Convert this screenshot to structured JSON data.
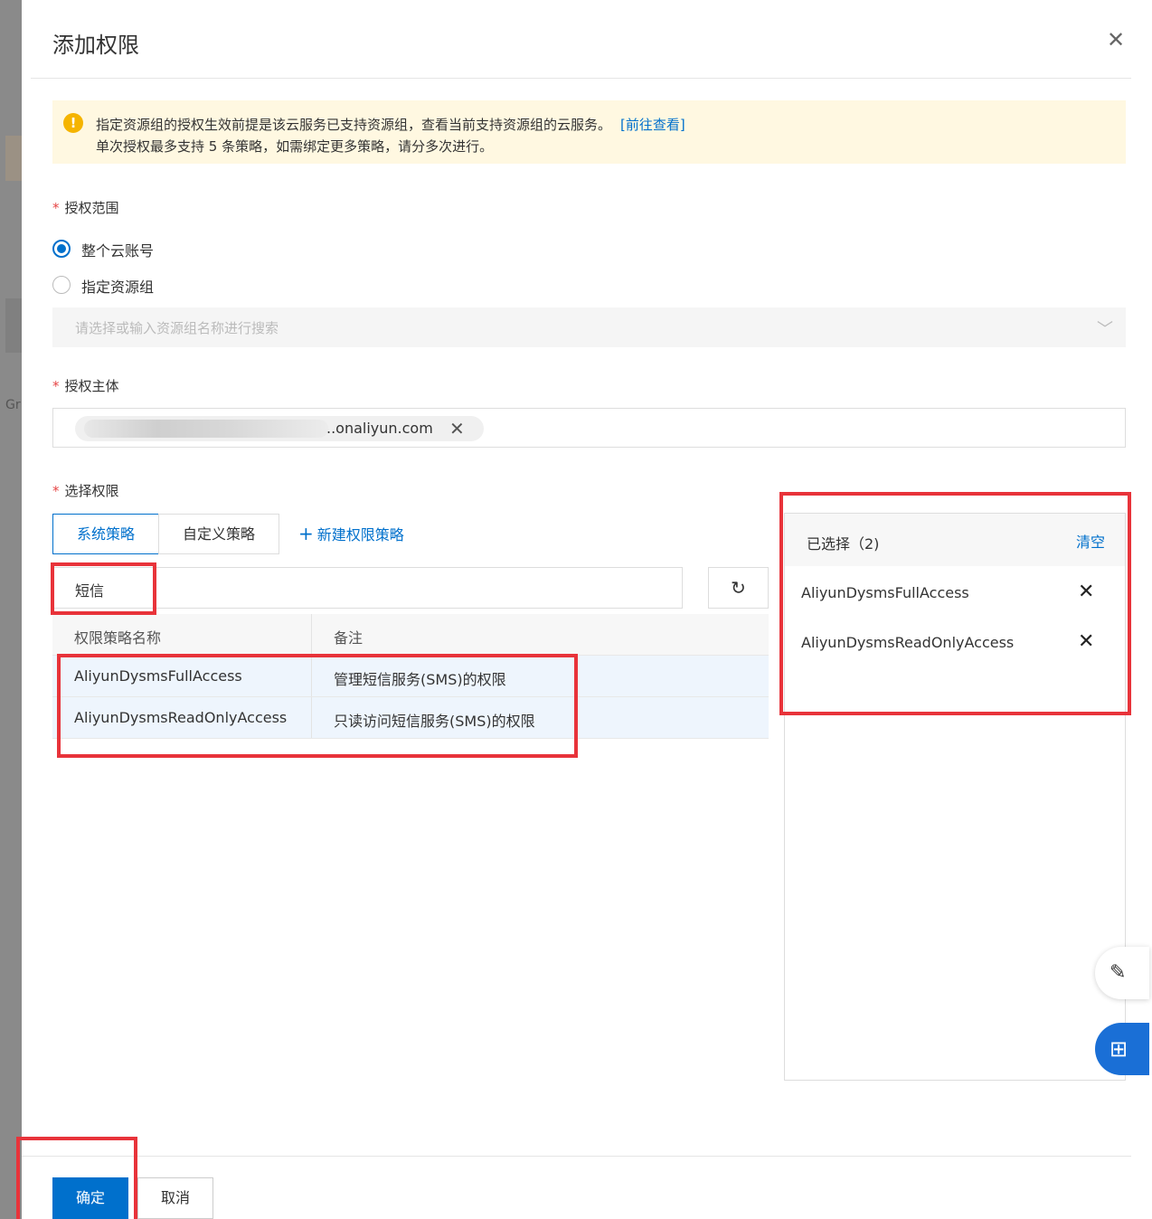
{
  "background": {
    "peek_text": "Gr"
  },
  "dialog": {
    "title": "添加权限",
    "close_icon": "close-icon"
  },
  "notice": {
    "line1": "指定资源组的授权生效前提是该云服务已支持资源组，查看当前支持资源组的云服务。",
    "link": "[前往查看]",
    "line2": "单次授权最多支持 5 条策略，如需绑定更多策略，请分多次进行。"
  },
  "scope": {
    "label": "授权范围",
    "options": [
      {
        "label": "整个云账号",
        "selected": true
      },
      {
        "label": "指定资源组",
        "selected": false
      }
    ],
    "resource_group_placeholder": "请选择或输入资源组名称进行搜索"
  },
  "principal": {
    "label": "授权主体",
    "tag_visible_text": "..onaliyun.com"
  },
  "permissions": {
    "label": "选择权限",
    "tabs": [
      "系统策略",
      "自定义策略"
    ],
    "active_tab": "系统策略",
    "new_policy": "新建权限策略",
    "search_value": "短信",
    "columns": [
      "权限策略名称",
      "备注"
    ],
    "rows": [
      {
        "name": "AliyunDysmsFullAccess",
        "note": "管理短信服务(SMS)的权限"
      },
      {
        "name": "AliyunDysmsReadOnlyAccess",
        "note": "只读访问短信服务(SMS)的权限"
      }
    ]
  },
  "selected_panel": {
    "title": "已选择（2)",
    "clear": "清空",
    "items": [
      "AliyunDysmsFullAccess",
      "AliyunDysmsReadOnlyAccess"
    ]
  },
  "footer": {
    "confirm": "确定",
    "cancel": "取消"
  },
  "colors": {
    "accent": "#0070cc",
    "highlight": "#e8333a",
    "notice_bg": "#fff8e1"
  }
}
